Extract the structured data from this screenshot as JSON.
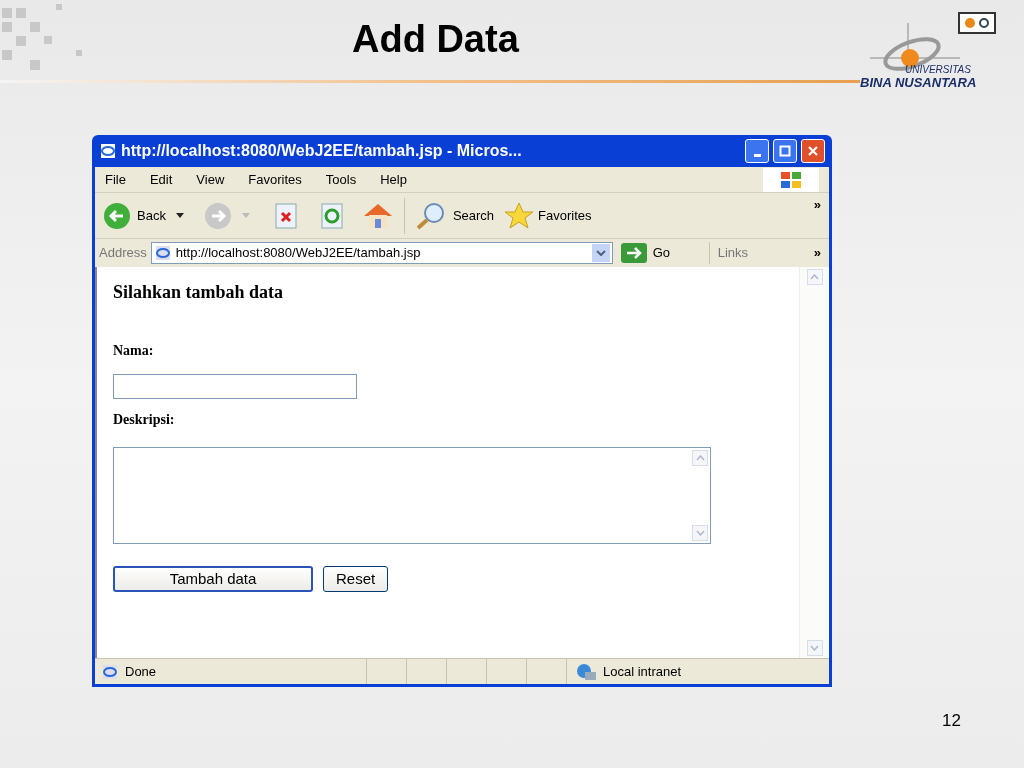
{
  "slide": {
    "title": "Add Data",
    "page_number": "12"
  },
  "logo": {
    "line1": "UNIVERSITAS",
    "line2_a": "BINA",
    "line2_b": "NUSANTARA"
  },
  "window": {
    "title": "http://localhost:8080/WebJ2EE/tambah.jsp - Micros..."
  },
  "menu": [
    "File",
    "Edit",
    "View",
    "Favorites",
    "Tools",
    "Help"
  ],
  "toolbar": {
    "back": "Back",
    "search": "Search",
    "favorites": "Favorites",
    "more": "»"
  },
  "address_bar": {
    "label": "Address",
    "url": "http://localhost:8080/WebJ2EE/tambah.jsp",
    "go": "Go",
    "links": "Links",
    "more": "»"
  },
  "page": {
    "heading": "Silahkan tambah data",
    "fields": [
      {
        "kind": "text",
        "label": "Nama:"
      },
      {
        "kind": "textarea",
        "label": "Deskripsi:"
      }
    ],
    "buttons": [
      {
        "label": "Tambah data",
        "default": true
      },
      {
        "label": "Reset",
        "default": false
      }
    ]
  },
  "status_bar": {
    "text": "Done",
    "zone": "Local intranet"
  }
}
